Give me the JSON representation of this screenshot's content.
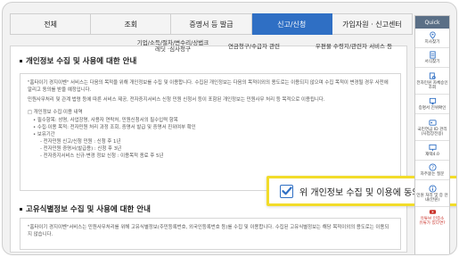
{
  "tabs": [
    {
      "label": "전체"
    },
    {
      "label": "조회"
    },
    {
      "label": "증명서 등 발급"
    },
    {
      "label": "신고/신청"
    },
    {
      "label": "가입자원 · 신고센터"
    }
  ],
  "subtabs": [
    {
      "label": "기업/소득/절차/변수리/상법크레딧 ·심사청구"
    },
    {
      "label": "연금청구/수급자 관련"
    },
    {
      "label": "우편물 수령지/관련자 서비스 등"
    }
  ],
  "section1": {
    "title": "개인정보 수집 및 사용에 대한 안내",
    "intro": "\"홈타이기 경지이벤\" 서비스는 다음의 목적을 위해 개인정보를 수집 및 이용합니다. 수집된 개인정보는 다음의 목적이외의 용도로는 이용되지 않으며 수집 목적이 변경될 경우 사전에 알리고 동의를 받을 예정입니다.",
    "intro2": "민원사무처리 및 관계 법령 등에 따른 서비스 제공, 전자증지서비스 신청 민원 신청서 등이 포함된 개인정보는 민원사무 처리 등 목적으로 이용됩니다.",
    "heading": "□ 개인정보 수집·이용 내역",
    "items": [
      "• 필수항목: 성명, 사업장명, 사용자 연락처, 민원신청서의 필수입력 항목",
      "• 수집·이용 목적: 전자민원 처리 과정 조회, 증명서 발급 및 증명서 진위여부 확인",
      "• 보유기간"
    ],
    "subitems": [
      "- 전자민원 신고/신청 민원 : 신청 후 1년",
      "- 전자민원 증명서(발급용) : 신청 후 3년",
      "- 전자증지서비스 신규·변경 정보 신청 : 이용목적 종료 후 5년"
    ]
  },
  "section2": {
    "title": "고유식별정보 수집 및 사용에 대한 안내",
    "intro": "\"홈타이기 경지이벤\"서비스는 민원사무처리를 위해 고유식별정보(주민등록번호, 외국인등록번호 등)를 수집 및 이용합니다. 수집된 고유식별정보는 해당 목적이외의 용도로는 이용되지 않습니다."
  },
  "consent": {
    "label": "위 개인정보 수집 및 이용에 동의합니다.",
    "checked": true
  },
  "quick": {
    "header": "Quick",
    "items": [
      {
        "label": "지사찾기",
        "icon": "map-pin-icon"
      },
      {
        "label": "서식찾기",
        "icon": "document-icon"
      },
      {
        "label": "전자민원 자체승인 조회",
        "icon": "document-search-icon"
      },
      {
        "label": "증명서 진위확인",
        "icon": "certificate-icon"
      },
      {
        "label": "국민연금 ID 관리 (사업장전용)",
        "icon": "id-card-icon"
      },
      {
        "label": "재택4.0",
        "icon": "monitor-icon"
      },
      {
        "label": "자주묻는 질문",
        "icon": "question-icon"
      },
      {
        "label": "민원 처리 및 증 안내(만원)",
        "icon": "info-icon"
      },
      {
        "label": "유튜브 인증소",
        "icon": "youtube-icon"
      },
      {
        "label": "유튜가 있다면?",
        "icon": "help-icon"
      }
    ]
  },
  "colors": {
    "accent": "#2f6fc4",
    "highlight": "#f2dc2a",
    "quick_header": "#5a6f86"
  }
}
